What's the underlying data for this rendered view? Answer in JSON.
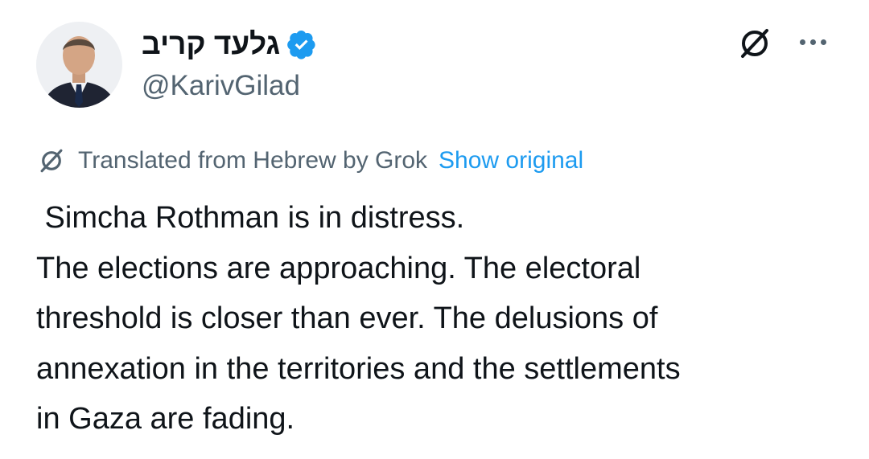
{
  "author": {
    "display_name": "גלעד קריב",
    "handle": "@KarivGilad",
    "verified": true
  },
  "icons": {
    "avatar": "profile-photo",
    "verified": "verified-badge-icon",
    "grok": "grok-icon",
    "more": "more-options-icon"
  },
  "translation": {
    "label": "Translated from Hebrew by Grok",
    "show_original": "Show original"
  },
  "tweet": {
    "lines": [
      " Simcha Rothman is in distress.",
      "The elections are approaching. The electoral",
      "threshold is closer than ever. The delusions of",
      "annexation in the territories and the settlements",
      "in Gaza are fading."
    ]
  },
  "colors": {
    "text": "#0f1419",
    "secondary": "#536471",
    "link": "#1d9bf0",
    "verified": "#1d9bf0"
  }
}
